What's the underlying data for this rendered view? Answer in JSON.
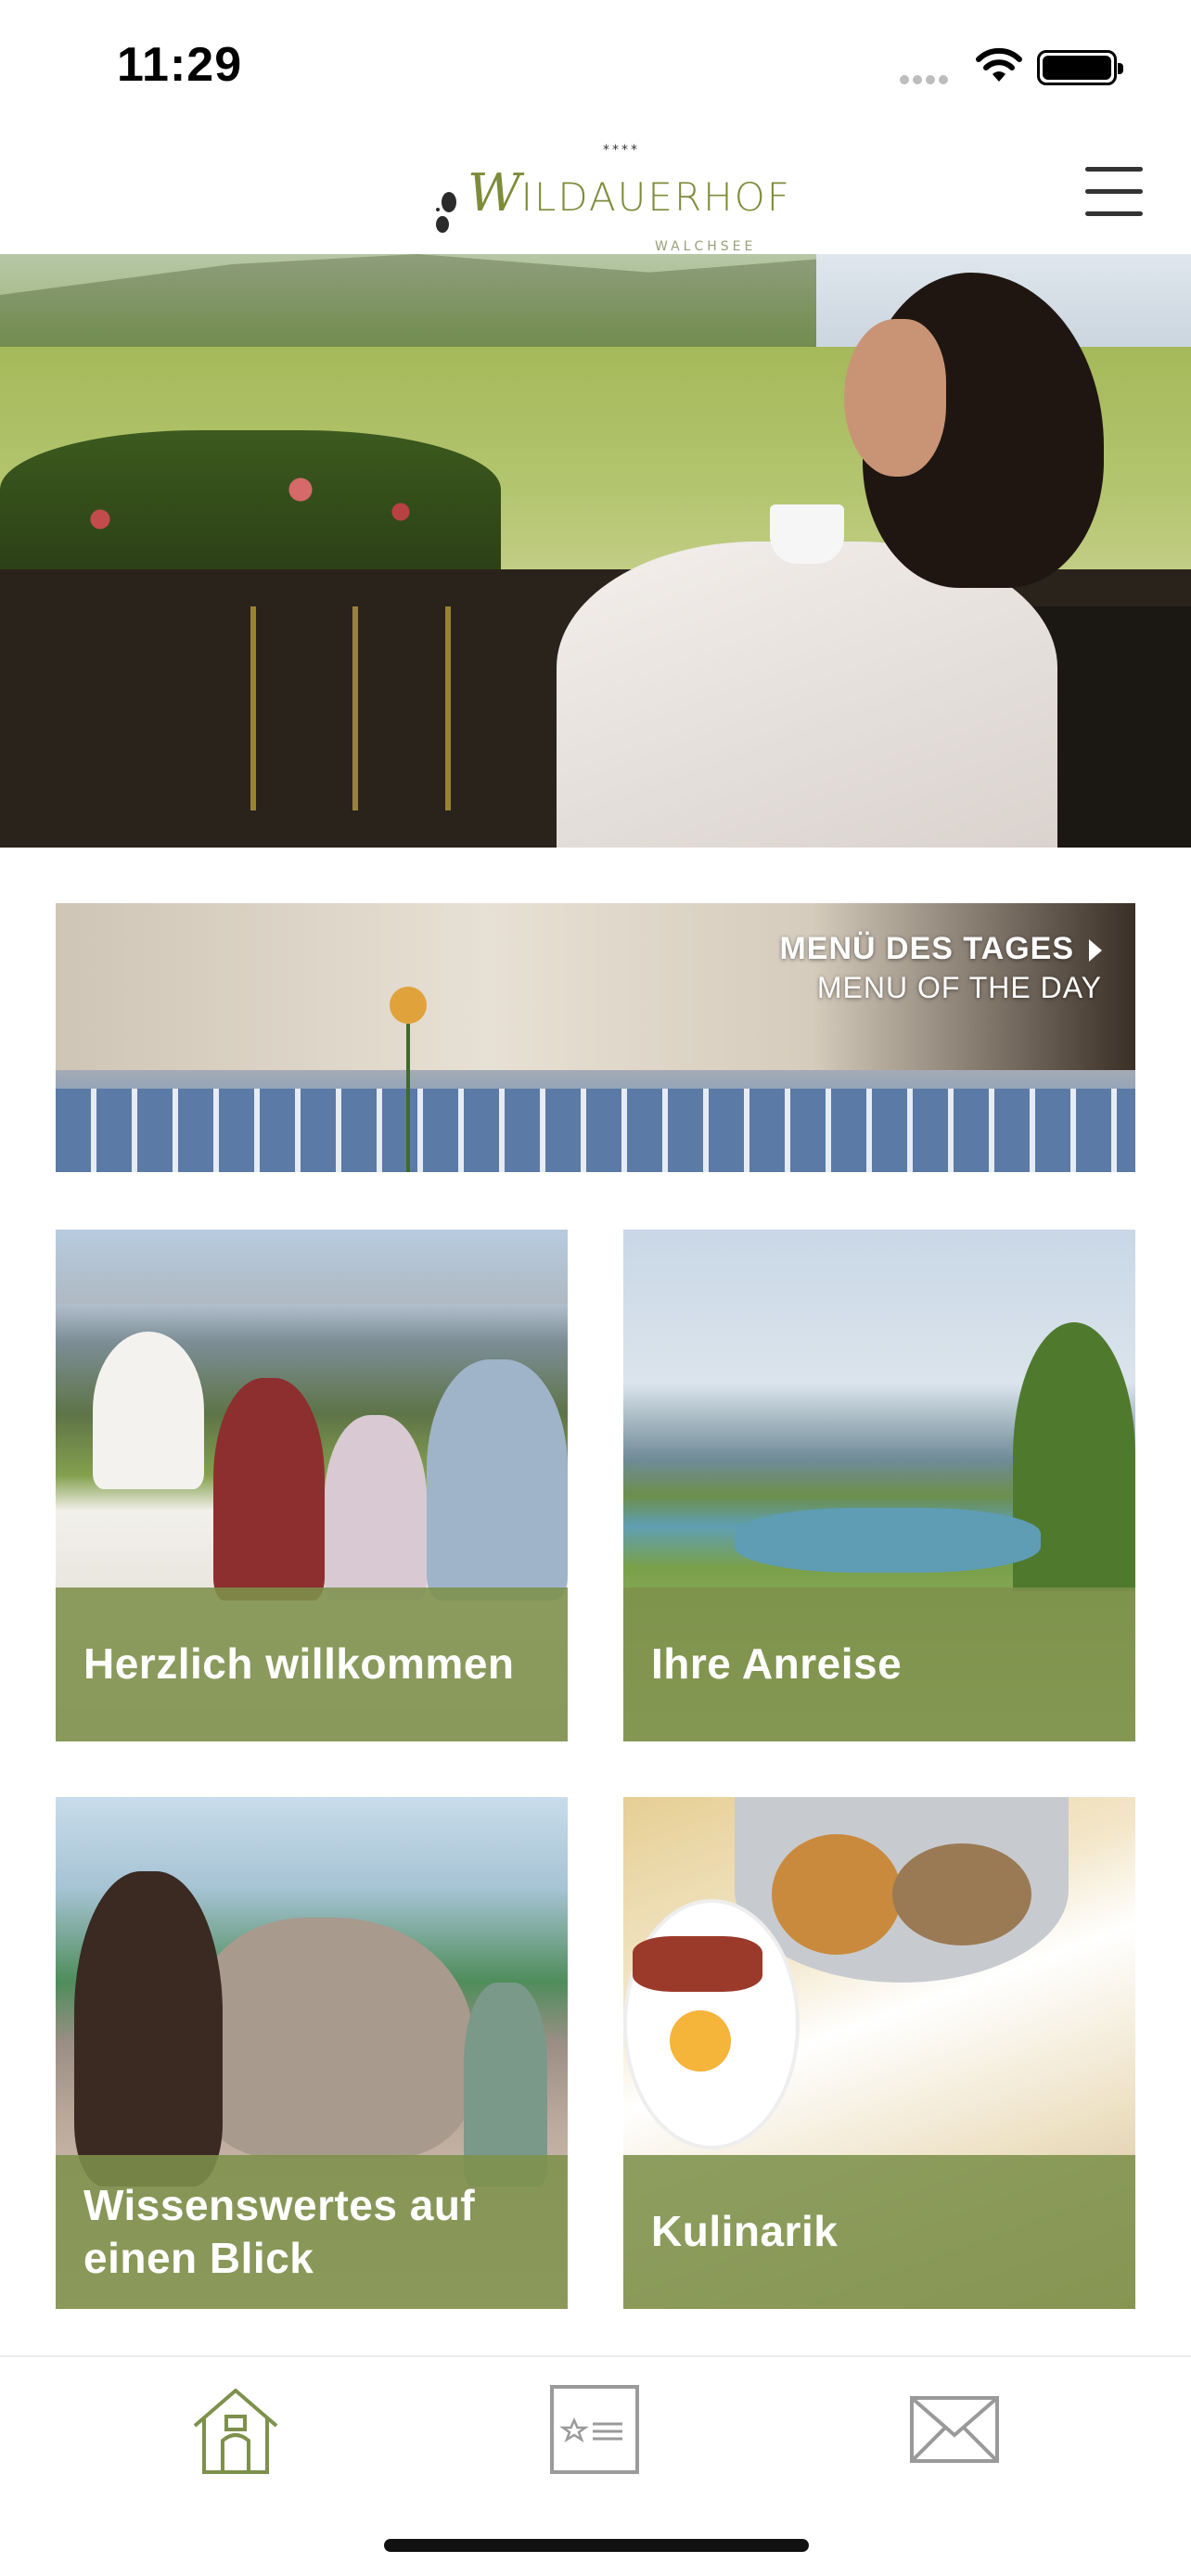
{
  "status_bar": {
    "time": "11:29"
  },
  "header": {
    "logo": {
      "stars": "****",
      "name_initial": "W",
      "name_rest": "ILDAUERHOF",
      "subtitle": "WALCHSEE"
    },
    "menu_icon": "hamburger-menu-icon"
  },
  "banner": {
    "title_de": "MENÜ DES TAGES",
    "title_en": "MENU OF THE DAY",
    "icon": "chevron-right-icon"
  },
  "tiles": [
    {
      "label": "Herzlich willkommen"
    },
    {
      "label": "Ihre Anreise"
    },
    {
      "label": "Wissenswertes auf einen Blick"
    },
    {
      "label": "Kulinarik"
    }
  ],
  "bottom_nav": {
    "items": [
      {
        "icon": "home-icon",
        "active": true
      },
      {
        "icon": "star-card-icon",
        "active": false
      },
      {
        "icon": "envelope-icon",
        "active": false
      }
    ]
  },
  "colors": {
    "brand_green": "#7d914b",
    "icon_gray": "#9a9a9a"
  }
}
